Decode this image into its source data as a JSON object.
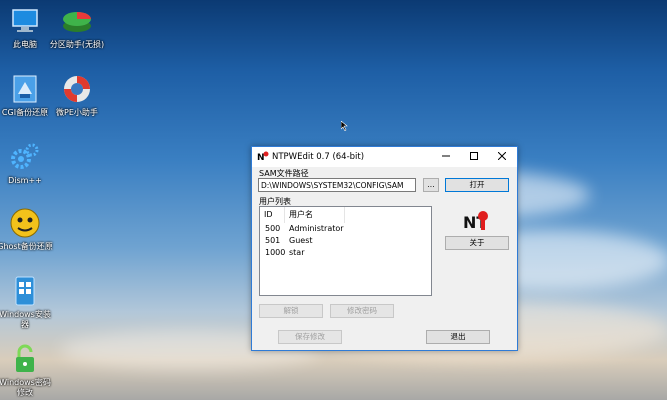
{
  "desktop": {
    "icons": [
      {
        "label": "此电脑",
        "icon": "computer-icon"
      },
      {
        "label": "分区助手(无损)",
        "icon": "partition-icon"
      },
      {
        "label": "CGI备份还原",
        "icon": "cgi-backup-icon"
      },
      {
        "label": "微PE小助手",
        "icon": "lifebuoy-icon"
      },
      {
        "label": "Dism++",
        "icon": "gears-icon"
      },
      {
        "label": "Ghost备份还原",
        "icon": "ghost-icon"
      },
      {
        "label": "Windows安装器",
        "icon": "windows-installer-icon"
      },
      {
        "label": "Windows密码修改",
        "icon": "lock-icon"
      }
    ]
  },
  "window": {
    "title": "NTPWEdit 0.7 (64-bit)",
    "sam_label": "SAM文件路径",
    "sam_path": "D:\\WINDOWS\\SYSTEM32\\CONFIG\\SAM",
    "browse_label": "...",
    "open_label": "打开",
    "user_list_label": "用户列表",
    "columns": [
      "ID",
      "用户名"
    ],
    "users": [
      {
        "id": "500",
        "name": "Administrator"
      },
      {
        "id": "501",
        "name": "Guest"
      },
      {
        "id": "1000",
        "name": "star"
      }
    ],
    "about_label": "关于",
    "unlock_label": "解锁",
    "change_password_label": "修改密码",
    "save_label": "保存修改",
    "exit_label": "退出",
    "logo_text": "NT"
  }
}
